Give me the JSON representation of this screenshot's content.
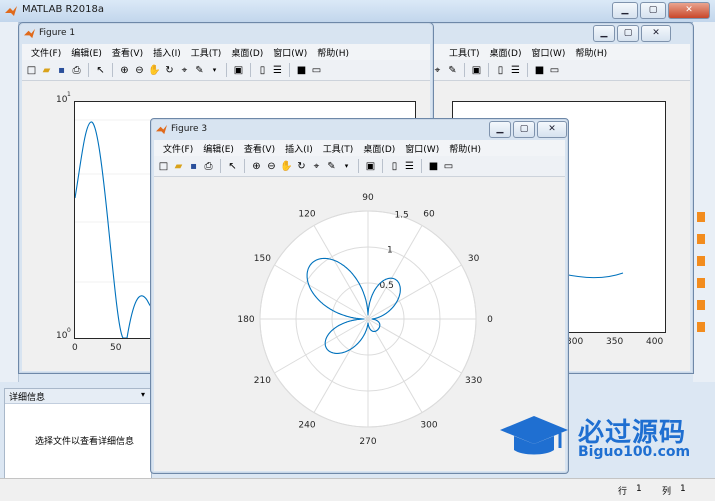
{
  "main_window": {
    "title": "MATLAB R2018a"
  },
  "figure1": {
    "title": "Figure 1",
    "menu": [
      "文件(F)",
      "编辑(E)",
      "查看(V)",
      "插入(I)",
      "工具(T)",
      "桌面(D)",
      "窗口(W)",
      "帮助(H)"
    ],
    "yticks": [
      "10",
      "10"
    ],
    "yexp": [
      "1",
      "0"
    ],
    "xticks": [
      "0",
      "50"
    ]
  },
  "figure2": {
    "menu": [
      "工具(T)",
      "桌面(D)",
      "窗口(W)",
      "帮助(H)"
    ],
    "xticks": [
      "300",
      "350",
      "400"
    ]
  },
  "figure3": {
    "title": "Figure 3",
    "menu": [
      "文件(F)",
      "编辑(E)",
      "查看(V)",
      "插入(I)",
      "工具(T)",
      "桌面(D)",
      "窗口(W)",
      "帮助(H)"
    ],
    "angles": [
      "90",
      "60",
      "30",
      "0",
      "330",
      "300",
      "270",
      "240",
      "210",
      "180",
      "150",
      "120"
    ],
    "radii": [
      "0.5",
      "1",
      "1.5"
    ]
  },
  "details_panel": {
    "title": "详细信息",
    "message": "选择文件以查看详细信息"
  },
  "status": {
    "row_label": "行",
    "row_value": "1",
    "col_label": "列",
    "col_value": "1"
  },
  "watermark": {
    "name": "必过源码",
    "url": "Biguo100.com"
  },
  "colors": {
    "line": "#0072bd",
    "title_bar": "#c6d9ee",
    "close": "#c8472a"
  }
}
